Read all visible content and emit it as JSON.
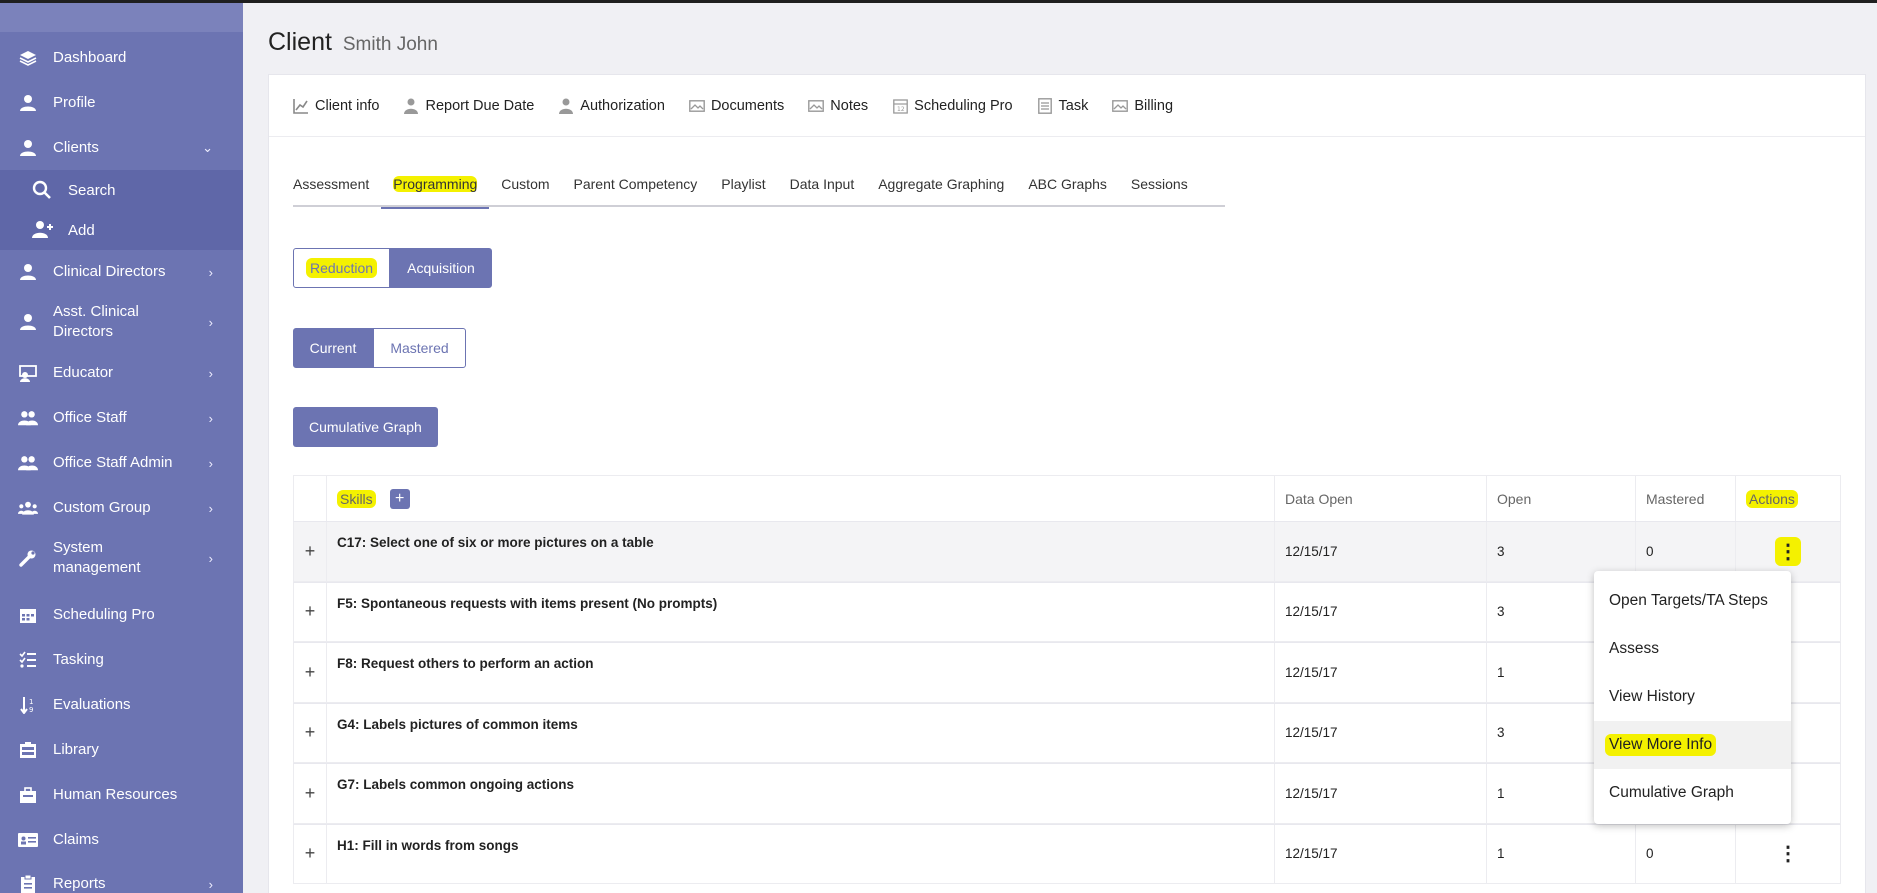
{
  "sidebar": {
    "items": [
      {
        "label": "Dashboard",
        "icon": "layers-icon"
      },
      {
        "label": "Profile",
        "icon": "user-icon"
      },
      {
        "label": "Clients",
        "icon": "user-icon",
        "chevron": "⌄"
      },
      {
        "label": "Clinical Directors",
        "icon": "user-tie-icon",
        "chevron": "›"
      },
      {
        "label": "Asst. Clinical Directors",
        "icon": "user-tie-icon",
        "chevron": "›"
      },
      {
        "label": "Educator",
        "icon": "teacher-icon",
        "chevron": "›"
      },
      {
        "label": "Office Staff",
        "icon": "users-icon",
        "chevron": "›"
      },
      {
        "label": "Office Staff Admin",
        "icon": "users-icon",
        "chevron": "›"
      },
      {
        "label": "Custom Group",
        "icon": "group-icon",
        "chevron": "›"
      },
      {
        "label": "System management",
        "icon": "wrench-icon",
        "chevron": "›"
      },
      {
        "label": "Scheduling Pro",
        "icon": "calendar-icon"
      },
      {
        "label": "Tasking",
        "icon": "tasks-icon"
      },
      {
        "label": "Evaluations",
        "icon": "sort-icon"
      },
      {
        "label": "Library",
        "icon": "library-icon"
      },
      {
        "label": "Human Resources",
        "icon": "briefcase-icon"
      },
      {
        "label": "Claims",
        "icon": "id-card-icon"
      },
      {
        "label": "Reports",
        "icon": "report-icon",
        "chevron": "›"
      }
    ],
    "sub_items": [
      {
        "label": "Search",
        "icon": "search-icon"
      },
      {
        "label": "Add",
        "icon": "user-plus-icon"
      }
    ]
  },
  "page": {
    "title": "Client",
    "subtitle": "Smith John"
  },
  "card_nav": [
    {
      "label": "Client info",
      "icon": "chart-icon"
    },
    {
      "label": "Report Due Date",
      "icon": "person-icon"
    },
    {
      "label": "Authorization",
      "icon": "person-icon"
    },
    {
      "label": "Documents",
      "icon": "image-icon"
    },
    {
      "label": "Notes",
      "icon": "image-icon"
    },
    {
      "label": "Scheduling Pro",
      "icon": "calendar-icon"
    },
    {
      "label": "Task",
      "icon": "list-icon"
    },
    {
      "label": "Billing",
      "icon": "image-icon"
    }
  ],
  "tabs": [
    "Assessment",
    "Programming",
    "Custom",
    "Parent Competency",
    "Playlist",
    "Data Input",
    "Aggregate Graphing",
    "ABC Graphs",
    "Sessions"
  ],
  "active_tab": "Programming",
  "type_toggle": {
    "options": [
      "Reduction",
      "Acquisition"
    ],
    "selected": "Acquisition"
  },
  "status_toggle": {
    "options": [
      "Current",
      "Mastered"
    ],
    "selected": "Current"
  },
  "cumulative_button": "Cumulative Graph",
  "table": {
    "headers": {
      "skills": "Skills",
      "data_open": "Data Open",
      "open": "Open",
      "mastered": "Mastered",
      "actions": "Actions"
    },
    "rows": [
      {
        "skill": "C17: Select one of six or more pictures on a table",
        "date": "12/15/17",
        "open": "3",
        "mastered": "0"
      },
      {
        "skill": "F5: Spontaneous requests with items present (No prompts)",
        "date": "12/15/17",
        "open": "3",
        "mastered": ""
      },
      {
        "skill": "F8: Request others to perform an action",
        "date": "12/15/17",
        "open": "1",
        "mastered": ""
      },
      {
        "skill": "G4: Labels pictures of common items",
        "date": "12/15/17",
        "open": "3",
        "mastered": ""
      },
      {
        "skill": "G7: Labels common ongoing actions",
        "date": "12/15/17",
        "open": "1",
        "mastered": ""
      },
      {
        "skill": "H1: Fill in words from songs",
        "date": "12/15/17",
        "open": "1",
        "mastered": "0"
      }
    ],
    "expand_symbol": "+",
    "action_symbol": "⋮"
  },
  "actions_menu": [
    "Open Targets/TA Steps",
    "Assess",
    "View History",
    "View More Info",
    "Cumulative Graph"
  ],
  "colors": {
    "sidebar": "#6c74b2",
    "accent": "#6c74b2",
    "highlight": "#f4f100"
  }
}
